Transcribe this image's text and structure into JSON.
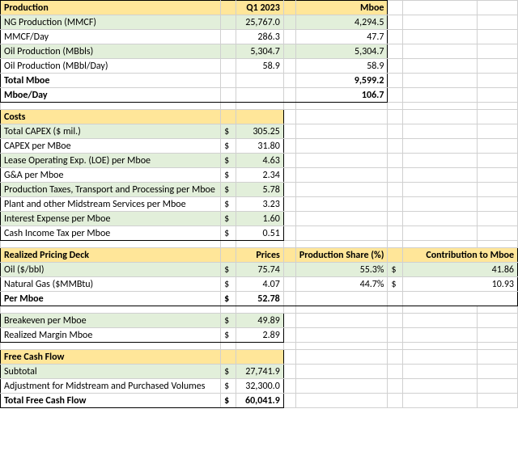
{
  "production": {
    "header": {
      "title": "Production",
      "q1": "Q1 2023",
      "mboe": "Mboe"
    },
    "rows": [
      {
        "label": "NG Production (MMCF)",
        "q1": "25,767.0",
        "mboe": "4,294.5"
      },
      {
        "label": "MMCF/Day",
        "q1": "286.3",
        "mboe": "47.7"
      },
      {
        "label": "Oil Production (MBbls)",
        "q1": "5,304.7",
        "mboe": "5,304.7"
      },
      {
        "label": "Oil Production (MBbl/Day)",
        "q1": "58.9",
        "mboe": "58.9"
      }
    ],
    "totals": [
      {
        "label": "Total Mboe",
        "value": "9,599.2"
      },
      {
        "label": "Mboe/Day",
        "value": "106.7"
      }
    ]
  },
  "costs": {
    "header": "Costs",
    "rows": [
      {
        "label": "Total CAPEX ($ mil.)",
        "value": "305.25"
      },
      {
        "label": "CAPEX per MBoe",
        "value": "31.80"
      },
      {
        "label": "Lease Operating Exp. (LOE) per Mboe",
        "value": "4.63"
      },
      {
        "label": "G&A per Mboe",
        "value": "2.34"
      },
      {
        "label": "Production Taxes, Transport and Processing per Mboe",
        "value": "5.78"
      },
      {
        "label": "Plant and other Midstream Services per Mboe",
        "value": "3.23"
      },
      {
        "label": "Interest Expense per Mboe",
        "value": "1.60"
      },
      {
        "label": "Cash Income Tax per Mboe",
        "value": "0.51"
      }
    ]
  },
  "pricing": {
    "header": {
      "title": "Realized Pricing Deck",
      "prices": "Prices",
      "share": "Production Share (%)",
      "contrib": "Contribution to Mboe"
    },
    "rows": [
      {
        "label": "Oil ($/bbl)",
        "price": "75.74",
        "share": "55.3%",
        "contrib": "41.86"
      },
      {
        "label": "Natural Gas ($MMBtu)",
        "price": "4.07",
        "share": "44.7%",
        "contrib": "10.93"
      }
    ],
    "total": {
      "label": "Per Mboe",
      "value": "52.78"
    }
  },
  "breakeven": {
    "rows": [
      {
        "label": "Breakeven per Mboe",
        "value": "49.89"
      },
      {
        "label": "Realized Margin Mboe",
        "value": "2.89"
      }
    ]
  },
  "fcf": {
    "header": "Free Cash Flow",
    "rows": [
      {
        "label": "Subtotal",
        "value": "27,741.9"
      },
      {
        "label": "Adjustment for Midstream and Purchased Volumes",
        "value": "32,300.0"
      }
    ],
    "total": {
      "label": "Total Free Cash Flow",
      "value": "60,041.9"
    }
  },
  "sym": {
    "dollar": "$"
  }
}
